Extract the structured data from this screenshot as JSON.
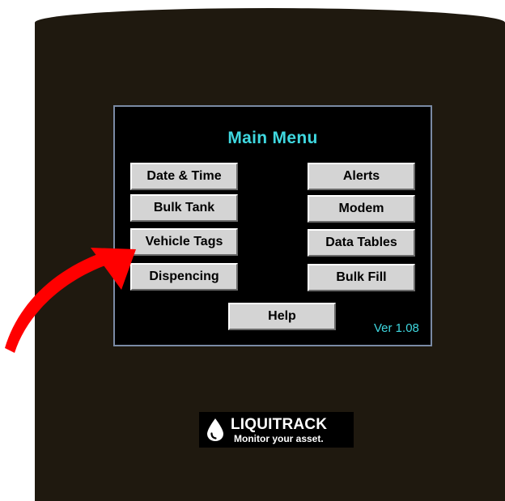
{
  "menu": {
    "title": "Main Menu",
    "version": "Ver 1.08",
    "left_buttons": [
      "Date & Time",
      "Bulk Tank",
      "Vehicle Tags",
      "Dispencing"
    ],
    "right_buttons": [
      "Alerts",
      "Modem",
      "Data Tables",
      "Bulk Fill"
    ],
    "help_label": "Help"
  },
  "logo": {
    "name": "LIQUITRACK",
    "tagline": "Monitor your asset."
  },
  "colors": {
    "screen_background": "#1f190f",
    "panel_background": "#000000",
    "panel_border": "#7a8aa4",
    "title_text": "#3fd8e0",
    "button_face": "#d4d4d4",
    "annotation_arrow": "#ff0000"
  },
  "annotation": {
    "icon": "red-curved-arrow-icon",
    "points_to": "Vehicle Tags"
  }
}
